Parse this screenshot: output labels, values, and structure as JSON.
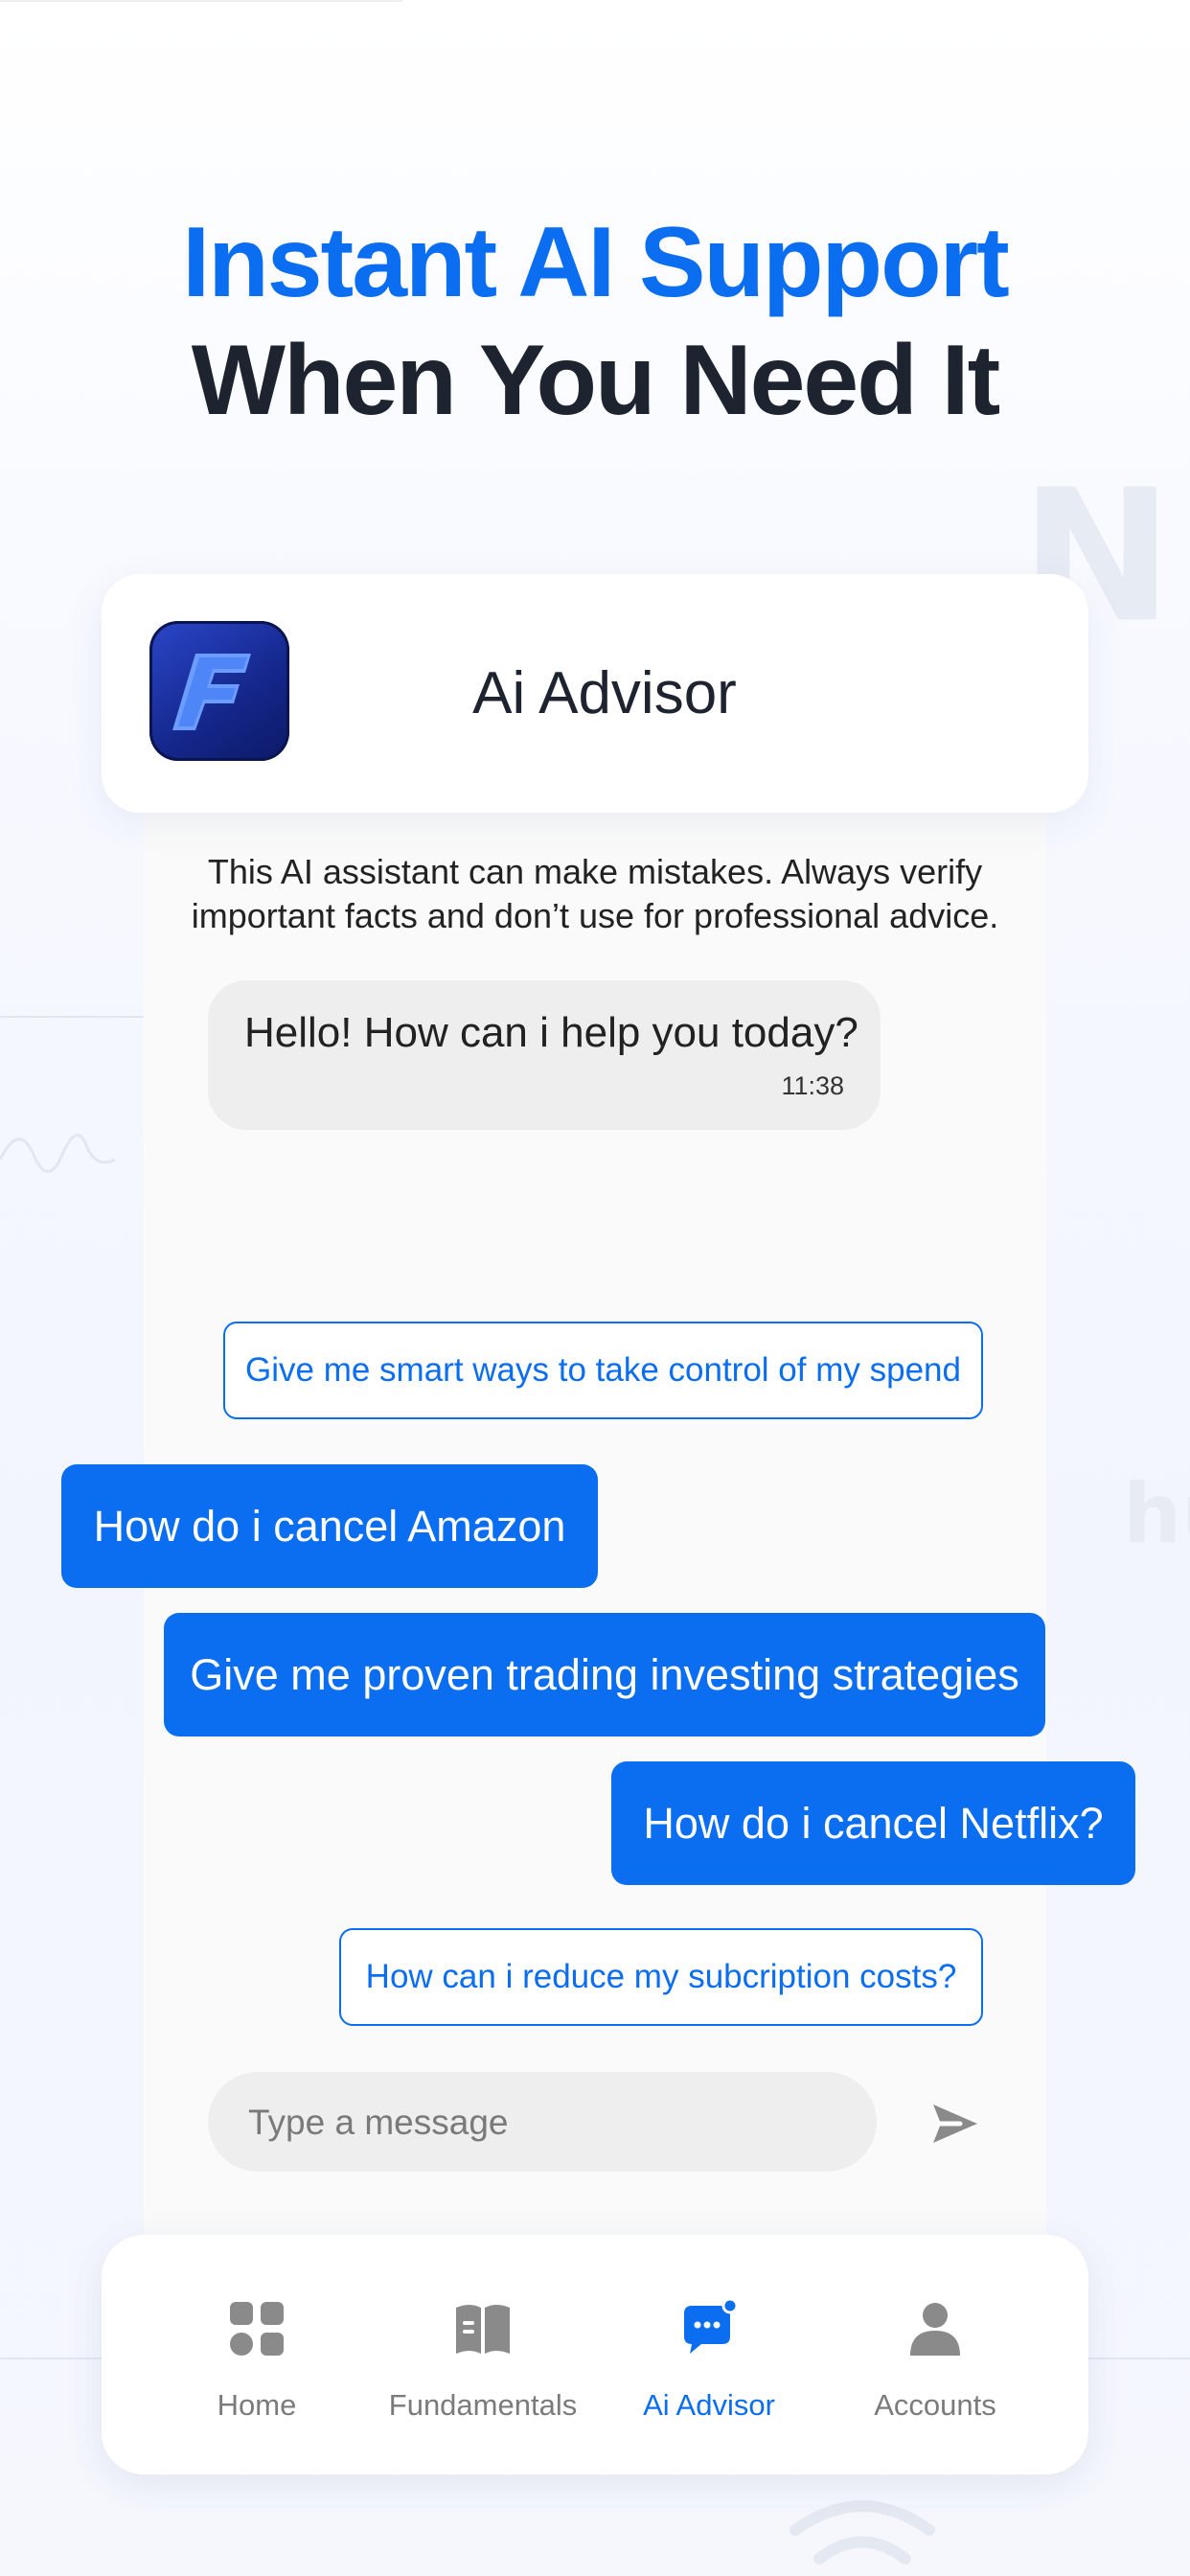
{
  "headline": {
    "line1": "Instant AI Support",
    "line2": "When You Need It"
  },
  "header": {
    "title": "Ai Advisor",
    "app_icon": "f-logo-icon"
  },
  "disclaimer": "This AI assistant can make mistakes. Always verify important facts and don’t use for professional advice.",
  "messages": [
    {
      "text": "Hello! How can i help you today?",
      "time": "11:38"
    }
  ],
  "suggestions": [
    "Give me smart ways to take control of my spend",
    "How do i cancel Amazon",
    "Give me proven trading investing strategies",
    "How do i cancel Netflix?",
    "How can i reduce my subcription costs?"
  ],
  "composer": {
    "placeholder": "Type a message",
    "send_icon": "send-icon"
  },
  "tabs": [
    {
      "label": "Home",
      "icon": "grid-icon",
      "active": false
    },
    {
      "label": "Fundamentals",
      "icon": "book-icon",
      "active": false
    },
    {
      "label": "Ai Advisor",
      "icon": "chat-icon",
      "active": true
    },
    {
      "label": "Accounts",
      "icon": "person-icon",
      "active": false
    }
  ],
  "colors": {
    "accent": "#0b6ef0",
    "heading": "#1e2330",
    "bubble": "#eeeeee"
  }
}
